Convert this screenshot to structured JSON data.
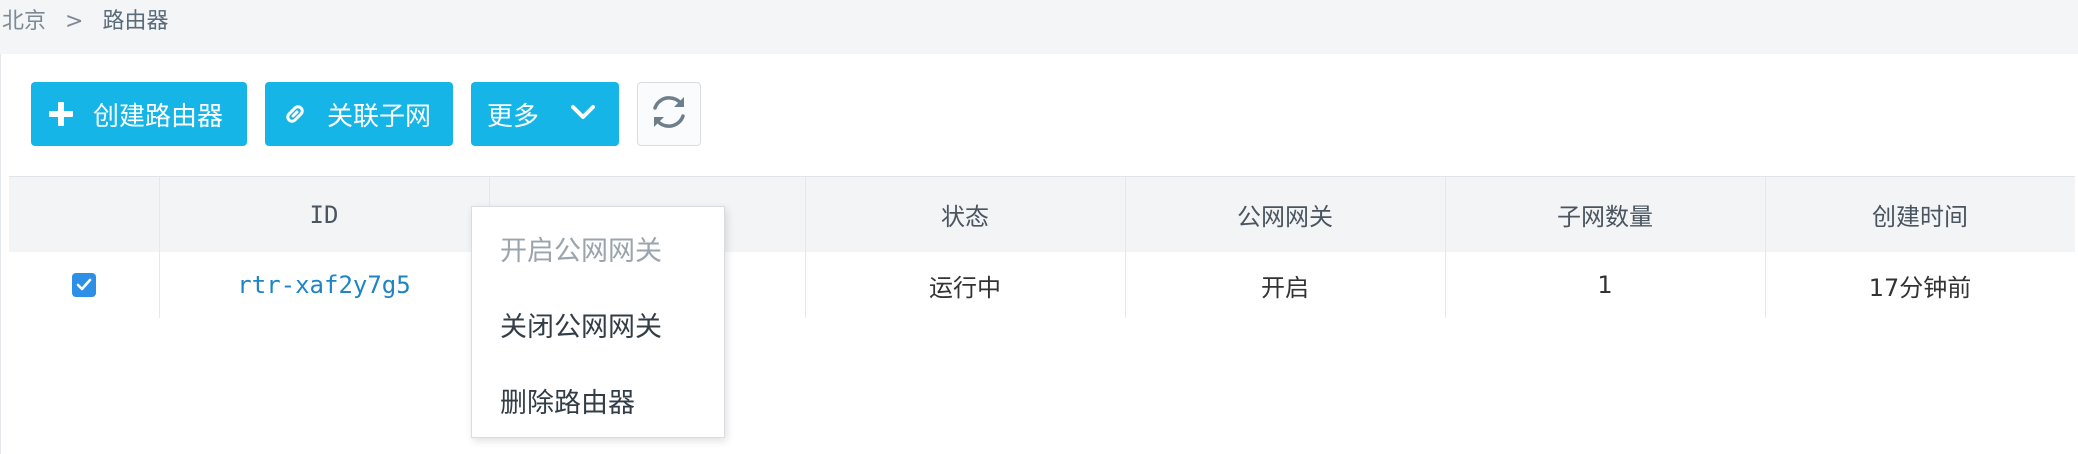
{
  "breadcrumb": {
    "region": "北京",
    "separator": ">",
    "current": "路由器"
  },
  "toolbar": {
    "create_label": "创建路由器",
    "associate_label": "关联子网",
    "more_label": "更多",
    "refresh_icon": "refresh-icon"
  },
  "table": {
    "headers": {
      "id": "ID",
      "status": "状态",
      "gateway": "公网网关",
      "subnet_count": "子网数量",
      "created": "创建时间"
    },
    "rows": [
      {
        "checked": true,
        "id": "rtr-xaf2y7g5",
        "status": "运行中",
        "gateway": "开启",
        "subnet_count": "1",
        "created": "17分钟前"
      }
    ]
  },
  "dropdown": {
    "items": [
      {
        "label": "开启公网网关",
        "enabled": false
      },
      {
        "label": "关闭公网网关",
        "enabled": true
      },
      {
        "label": "删除路由器",
        "enabled": true
      }
    ]
  },
  "colors": {
    "primary": "#16b5e8",
    "link": "#1d84c6",
    "checkbox": "#2d8fe6"
  }
}
